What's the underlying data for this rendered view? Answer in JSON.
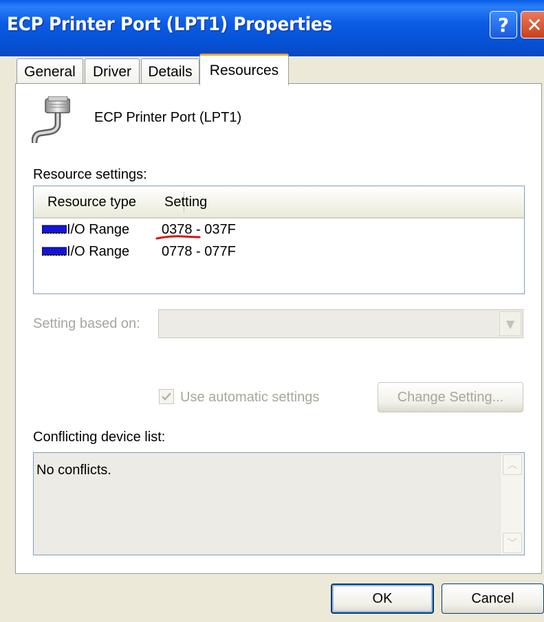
{
  "window": {
    "title": "ECP Printer Port (LPT1) Properties",
    "help_label": "?",
    "close_label": "✕"
  },
  "tabs": [
    {
      "label": "General",
      "selected": false
    },
    {
      "label": "Driver",
      "selected": false
    },
    {
      "label": "Details",
      "selected": false
    },
    {
      "label": "Resources",
      "selected": true
    }
  ],
  "device": {
    "icon": "printer-port-icon",
    "name": "ECP Printer Port (LPT1)"
  },
  "resources": {
    "label": "Resource settings:",
    "columns": [
      "Resource type",
      "Setting"
    ],
    "rows": [
      {
        "icon": "memory-chip-icon",
        "type": "I/O Range",
        "setting": "0378 - 037F"
      },
      {
        "icon": "memory-chip-icon",
        "type": "I/O Range",
        "setting": "0778 - 077F"
      }
    ],
    "annotation_color": "#e01010"
  },
  "setting_based_on": {
    "label": "Setting based on:",
    "value": "",
    "enabled": false
  },
  "auto_settings": {
    "label": "Use automatic settings",
    "checked": true,
    "enabled": false
  },
  "change_setting_button": {
    "label": "Change Setting...",
    "enabled": false
  },
  "conflicts": {
    "label": "Conflicting device list:",
    "text": "No conflicts."
  },
  "buttons": {
    "ok": "OK",
    "cancel": "Cancel"
  },
  "colors": {
    "titlebar": "#0553d8",
    "dialog_bg": "#ece9d8",
    "disabled_text": "#a8a69a",
    "tab_highlight": "#f5a623"
  }
}
